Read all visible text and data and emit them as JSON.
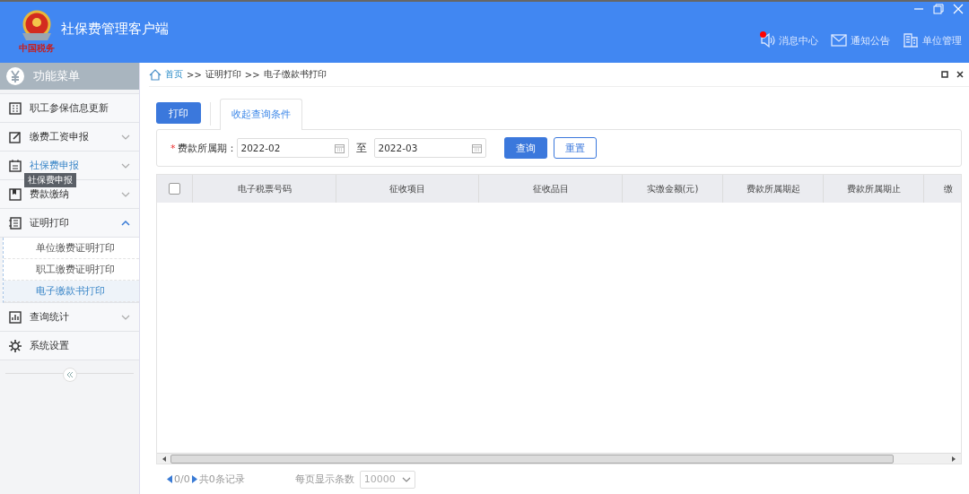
{
  "app": {
    "title": "社保费管理客户端",
    "logo_text": "中国税务"
  },
  "header_actions": [
    {
      "label": "消息中心",
      "unread": true
    },
    {
      "label": "通知公告",
      "unread": false
    },
    {
      "label": "单位管理",
      "unread": false
    }
  ],
  "sidebar": {
    "title": "功能菜单",
    "items": [
      {
        "label": "职工参保信息更新",
        "kind": "link",
        "selected": false
      },
      {
        "label": "缴费工资申报",
        "kind": "group",
        "expanded": false,
        "selected": false
      },
      {
        "label": "社保费申报",
        "kind": "group",
        "expanded": false,
        "selected": true,
        "tooltip": "社保费申报"
      },
      {
        "label": "费款缴纳",
        "kind": "group",
        "expanded": false,
        "selected": false
      },
      {
        "label": "证明打印",
        "kind": "group",
        "expanded": true,
        "selected": false,
        "children": [
          {
            "label": "单位缴费证明打印",
            "selected": false
          },
          {
            "label": "职工缴费证明打印",
            "selected": false
          },
          {
            "label": "电子缴款书打印",
            "selected": true
          }
        ]
      },
      {
        "label": "查询统计",
        "kind": "group",
        "expanded": false,
        "selected": false
      },
      {
        "label": "系统设置",
        "kind": "link",
        "selected": false
      }
    ]
  },
  "breadcrumb": [
    "首页",
    ">>",
    "证明打印",
    ">>",
    "电子缴款书打印"
  ],
  "toolbar": {
    "print_button": "打印",
    "tabs": [
      {
        "label": "收起查询条件",
        "selected": true
      }
    ]
  },
  "filter": {
    "label": "费款所属期：",
    "required": true,
    "required_mark": "*",
    "from": "2022-02",
    "separator": "至",
    "to": "2022-03",
    "buttons": [
      {
        "label": "查询",
        "kind": "primary"
      },
      {
        "label": "重置",
        "kind": "outline"
      }
    ]
  },
  "table": {
    "select_all_checked": false,
    "columns": [
      "电子税票号码",
      "征收项目",
      "征收品目",
      "实缴金额(元)",
      "费款所属期起",
      "费款所属期止",
      "缴"
    ]
  },
  "pager": {
    "position": "0/0",
    "total": "共0条记录",
    "page_size_label": "每页显示条数",
    "page_size": "10000"
  }
}
